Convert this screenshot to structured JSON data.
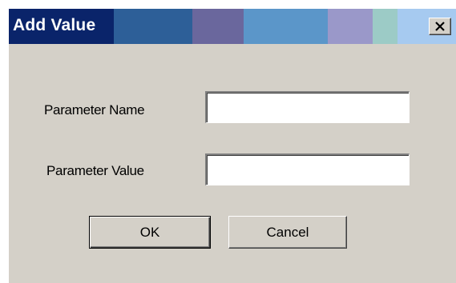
{
  "window": {
    "title": "Add Value",
    "close_icon": "close-icon"
  },
  "titlebar_colors": [
    "#0a246a",
    "#2d5f98",
    "#6a679d",
    "#5b96c9",
    "#9a98c9",
    "#9ccbc6",
    "#a6caf0"
  ],
  "form": {
    "name_label": "Parameter Name",
    "name_value": "",
    "value_label": "Parameter Value",
    "value_value": ""
  },
  "buttons": {
    "ok_label": "OK",
    "cancel_label": "Cancel"
  }
}
